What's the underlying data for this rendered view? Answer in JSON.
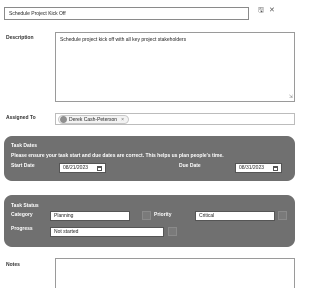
{
  "title": {
    "value": "Schedule Project Kick Off",
    "save_icon": "save-icon",
    "close_icon": "close-icon"
  },
  "description": {
    "label": "Description",
    "value": "Schedule project kick off with all key project stakeholders"
  },
  "assigned_to": {
    "label": "Assigned To",
    "person": "Derek Cash-Peterson",
    "remove_glyph": "×"
  },
  "task_dates": {
    "title": "Task Dates",
    "message": "Please ensure your task start and due dates are correct. This helps us plan people's time.",
    "start_label": "Start Date",
    "start_value": "08/21/2023",
    "due_label": "Due Date",
    "due_value": "08/31/2023"
  },
  "task_status": {
    "title": "Task Status",
    "category_label": "Category",
    "category_value": "Planning",
    "priority_label": "Priority",
    "priority_value": "Critical",
    "progress_label": "Progress",
    "progress_value": "Not started"
  },
  "notes": {
    "label": "Notes",
    "value": ""
  },
  "colors": {
    "panel_bg": "#707070",
    "panel_text": "#ffffff"
  }
}
